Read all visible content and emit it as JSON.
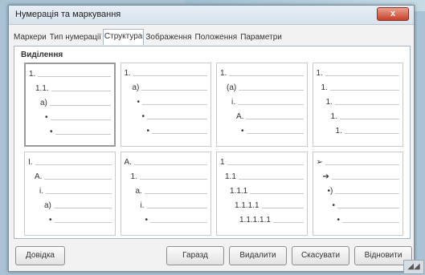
{
  "window": {
    "title": "Нумерація та маркування",
    "close_label": "x"
  },
  "tabs": [
    {
      "label": "Маркери"
    },
    {
      "label": "Тип нумерації"
    },
    {
      "label": "Структура"
    },
    {
      "label": "Зображення"
    },
    {
      "label": "Положення"
    },
    {
      "label": "Параметри"
    }
  ],
  "active_tab": 2,
  "section": {
    "label": "Виділення"
  },
  "presets": [
    {
      "lines": [
        "1.",
        "1.1.",
        "a)",
        "•",
        "•"
      ]
    },
    {
      "lines": [
        "1.",
        "a)",
        "•",
        "•",
        "•"
      ]
    },
    {
      "lines": [
        "1.",
        "(a)",
        "i.",
        "A.",
        "•"
      ]
    },
    {
      "lines": [
        "1.",
        "1.",
        "1.",
        "1.",
        "1."
      ]
    },
    {
      "lines": [
        "I.",
        "A.",
        "i.",
        "a)",
        "•"
      ]
    },
    {
      "lines": [
        "A.",
        "1.",
        "a.",
        "i.",
        "•"
      ]
    },
    {
      "lines": [
        "1",
        "1.1",
        "1.1.1",
        "1.1.1.1",
        "1.1.1.1.1"
      ]
    },
    {
      "lines": [
        "➢",
        "➔",
        "•)",
        "•",
        "•"
      ]
    }
  ],
  "selected_preset": 0,
  "buttons": {
    "help": "Довідка",
    "reset": "Гаразд",
    "delete": "Видалити",
    "cancel": "Скасувати",
    "restore": "Відновити"
  },
  "corner_icon": "resize-grip-icon"
}
